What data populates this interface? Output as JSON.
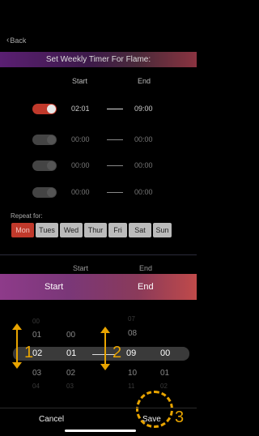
{
  "nav": {
    "back_label": "Back"
  },
  "banner": {
    "title": "Set Weekly Timer For Flame:"
  },
  "columns": {
    "start": "Start",
    "end": "End"
  },
  "timers": [
    {
      "enabled": true,
      "start": "02:01",
      "end": "09:00"
    },
    {
      "enabled": false,
      "start": "00:00",
      "end": "00:00"
    },
    {
      "enabled": false,
      "start": "00:00",
      "end": "00:00"
    },
    {
      "enabled": false,
      "start": "00:00",
      "end": "00:00"
    }
  ],
  "repeat": {
    "label": "Repeat for:",
    "days": [
      {
        "label": "Mon",
        "selected": true
      },
      {
        "label": "Tues",
        "selected": false
      },
      {
        "label": "Wed",
        "selected": false
      },
      {
        "label": "Thur",
        "selected": false
      },
      {
        "label": "Fri",
        "selected": false
      },
      {
        "label": "Sat",
        "selected": false
      },
      {
        "label": "Sun",
        "selected": false
      }
    ]
  },
  "picker": {
    "header_start": "Start",
    "header_end": "End",
    "tab_start": "Start",
    "tab_end": "End",
    "start_hours": [
      "00",
      "01",
      "02",
      "03",
      "04"
    ],
    "start_minutes": [
      "00",
      "01",
      "02",
      "03"
    ],
    "end_hours": [
      "07",
      "08",
      "09",
      "10",
      "11"
    ],
    "end_minutes": [
      "00",
      "01",
      "02"
    ],
    "selected": {
      "start_hour": "02",
      "start_minute": "01",
      "end_hour": "09",
      "end_minute": "00"
    }
  },
  "annotations": {
    "one": "1",
    "two": "2",
    "three": "3"
  },
  "footer": {
    "cancel_label": "Cancel",
    "save_label": "Save"
  },
  "colors": {
    "accent_red": "#c0392b",
    "annotation": "#e8a400"
  }
}
